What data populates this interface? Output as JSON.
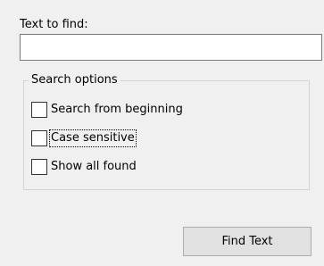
{
  "find": {
    "label": "Text to find:",
    "value": "",
    "placeholder": ""
  },
  "search_options": {
    "title": "Search options",
    "options": [
      {
        "label": "Search from beginning",
        "checked": false,
        "focused": false
      },
      {
        "label": "Case sensitive",
        "checked": false,
        "focused": true
      },
      {
        "label": "Show all found",
        "checked": false,
        "focused": false
      }
    ]
  },
  "actions": {
    "find_text_label": "Find Text"
  }
}
